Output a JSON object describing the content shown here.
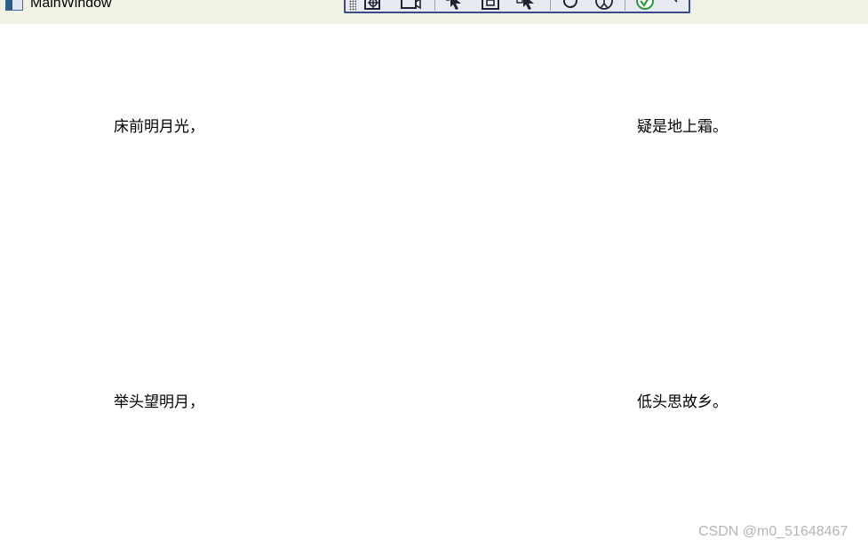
{
  "window": {
    "title": "MainWindow"
  },
  "debug_toolbar": {
    "icons": [
      "crosshair-select-icon",
      "camera-icon",
      "pointer-select-icon",
      "frame-icon",
      "pointer-inspect-icon",
      "refresh-icon",
      "accessibility-icon",
      "checkmark-icon",
      "collapse-icon"
    ],
    "accent_color": "#3a4a8a",
    "check_color": "#2e9a3e"
  },
  "content": {
    "line1": "床前明月光，",
    "line2": "疑是地上霜。",
    "line3": "举头望明月，",
    "line4": "低头思故乡。"
  },
  "watermark": {
    "text": "CSDN @m0_51648467"
  }
}
